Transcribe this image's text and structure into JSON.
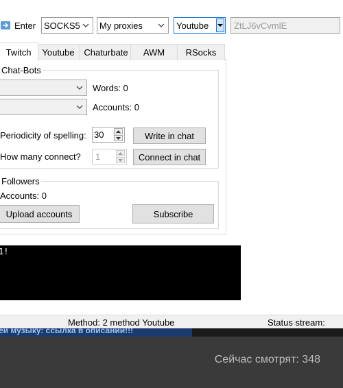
{
  "toolbar": {
    "enter_label": "Enter",
    "proxy_type": "SOCKS5",
    "proxy_list": "My proxies",
    "platform": "Youtube",
    "token_value": "ZtLJ6vCvmlE"
  },
  "tabs": [
    {
      "label": "Twitch",
      "active": true
    },
    {
      "label": "Youtube",
      "active": false
    },
    {
      "label": "Chaturbate",
      "active": false
    },
    {
      "label": "AWM",
      "active": false
    },
    {
      "label": "RSocks",
      "active": false
    }
  ],
  "chat_bots": {
    "title": "Chat-Bots",
    "words_label": "Words: 0",
    "accounts_label": "Accounts: 0",
    "periodicity_label": "Periodicity of spelling:",
    "periodicity_value": "30",
    "write_button": "Write in chat",
    "connect_count_label": "How many connect?",
    "connect_count_value": "1",
    "connect_button": "Connect in chat"
  },
  "followers": {
    "title": "Followers",
    "accounts_label": "Accounts: 0",
    "upload_button": "Upload accounts",
    "subscribe_button": "Subscribe"
  },
  "console": {
    "text": "1!"
  },
  "status_bar": {
    "method": "Method: 2 method Youtube",
    "stream_status": "Status stream:"
  },
  "video": {
    "banner_text": "ей музыку: ссылка в описании!!!",
    "viewers": "Сейчас смотрят: 348"
  },
  "colors": {
    "accent": "#1e78d7",
    "window_bg": "#f0f0f0",
    "console_bg": "#000000"
  }
}
